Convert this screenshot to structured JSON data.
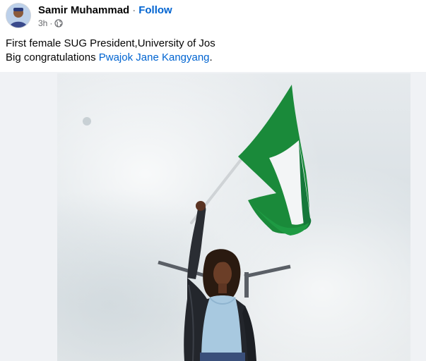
{
  "post": {
    "author": "Samir Muhammad",
    "separator": "·",
    "follow_label": "Follow",
    "timestamp": "3h",
    "audience_icon": "globe-icon",
    "text_line1": "First female SUG President,University of Jos",
    "text_line2_prefix": "Big congratulations ",
    "mention": "Pwajok Jane Kangyang",
    "text_line2_suffix": "."
  },
  "colors": {
    "link": "#0064d1",
    "secondary_text": "#65676b",
    "flag_green": "#1a8a3a",
    "flag_white": "#ffffff"
  }
}
